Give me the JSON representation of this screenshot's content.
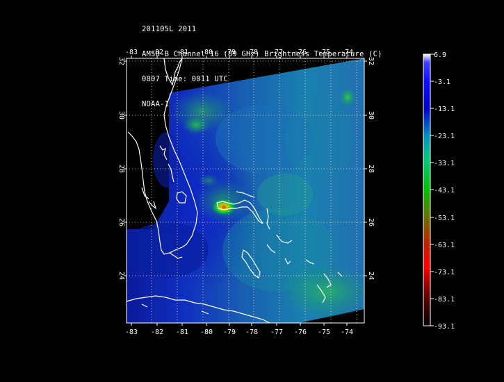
{
  "header": {
    "line1": "201105L 2011",
    "line2": "AMSU-B Channel 16 (89 GHz) Brightness Temperature (C)",
    "line3": "0807 Time: 0011 UTC",
    "line4": "NOAA-16"
  },
  "map": {
    "lon_labels": [
      "-83",
      "-82",
      "-81",
      "-80",
      "-79",
      "-78",
      "-77",
      "-76",
      "-75",
      "-74"
    ],
    "lat_labels": [
      "32",
      "30",
      "28",
      "26",
      "24"
    ],
    "lon_range": [
      -83.2,
      -73.2
    ],
    "lat_range": [
      22.9,
      32.2
    ],
    "coastline_color": "#ffffff",
    "background_color": "#000000"
  },
  "colorbar": {
    "labels": [
      "6.9",
      "-3.1",
      "-13.1",
      "-23.1",
      "-33.1",
      "-43.1",
      "-53.1",
      "-63.1",
      "-73.1",
      "-83.1",
      "-93.1"
    ],
    "range": [
      6.9,
      -93.1
    ],
    "colors": [
      "#ffffff",
      "#1a1aff",
      "#0000cc",
      "#00a0d0",
      "#00d060",
      "#00c000",
      "#806000",
      "#c00000",
      "#ff0000",
      "#400000",
      "#000000"
    ]
  }
}
